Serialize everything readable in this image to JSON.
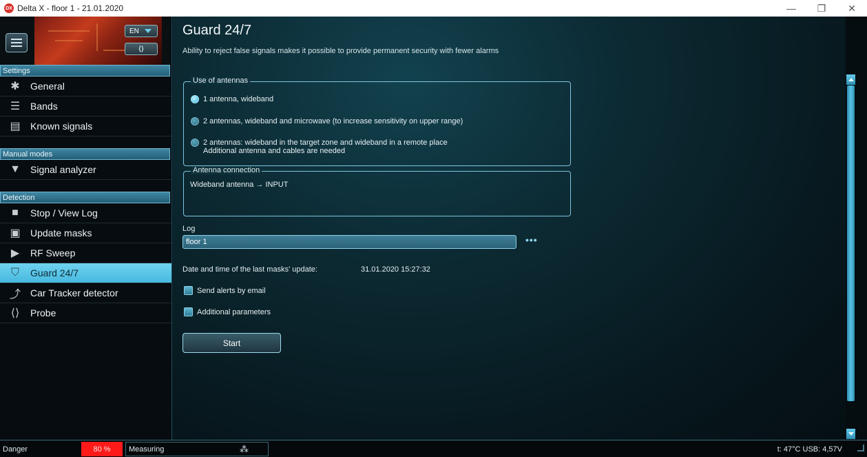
{
  "window": {
    "title": "Delta X - floor 1 - 21.01.2020",
    "app_logo": "DX",
    "controls": {
      "minimize": "—",
      "maximize": "❐",
      "close": "✕"
    }
  },
  "sidebar": {
    "lang": "EN",
    "code_label": "⟨⟩",
    "sections": {
      "settings": "Settings",
      "manual": "Manual modes",
      "detection": "Detection"
    },
    "settings_items": [
      {
        "label": "General",
        "icon": "gear-icon"
      },
      {
        "label": "Bands",
        "icon": "list-icon"
      },
      {
        "label": "Known signals",
        "icon": "clipboard-icon"
      }
    ],
    "manual_items": [
      {
        "label": "Signal analyzer",
        "icon": "wifi-icon"
      }
    ],
    "detection_items": [
      {
        "label": "Stop / View Log",
        "icon": "stop-icon"
      },
      {
        "label": "Update masks",
        "icon": "image-icon"
      },
      {
        "label": "RF Sweep",
        "icon": "play-icon"
      },
      {
        "label": "Guard 24/7",
        "icon": "shield-icon",
        "active": true
      },
      {
        "label": "Car Tracker detector",
        "icon": "trend-icon"
      },
      {
        "label": "Probe",
        "icon": "code-icon"
      }
    ]
  },
  "main": {
    "title": "Guard 24/7",
    "description": "Ability to reject false signals makes it possible to provide permanent security with fewer alarms",
    "antennas": {
      "legend": "Use of antennas",
      "options": [
        {
          "line1": "1 antenna, wideband",
          "line2": "",
          "selected": true
        },
        {
          "line1": "2 antennas, wideband and microwave (to increase sensitivity on upper range)",
          "line2": "",
          "selected": false
        },
        {
          "line1": "2 antennas: wideband in the target zone and wideband in a remote place",
          "line2": "Additional antenna and cables are needed",
          "selected": false
        }
      ]
    },
    "connection": {
      "legend": "Antenna connection",
      "text": "Wideband antenna → INPUT"
    },
    "log": {
      "label": "Log",
      "value": "floor 1",
      "browse": "•••"
    },
    "last_update": {
      "label": "Date and time of the last masks' update:",
      "value": "31.01.2020 15:27:32"
    },
    "send_alerts": {
      "label": "Send alerts by email",
      "checked": false
    },
    "additional": {
      "label": "Additional parameters",
      "checked": false
    },
    "start_label": "Start"
  },
  "status": {
    "danger_label": "Danger",
    "danger_value": "80 %",
    "measuring_label": "Measuring",
    "spinner": "⁂",
    "right_text": "t: 47°C  USB: 4,57V"
  },
  "colors": {
    "accent": "#47b9df",
    "danger": "#ff1a1a",
    "section_header": "#2f6f8a"
  }
}
